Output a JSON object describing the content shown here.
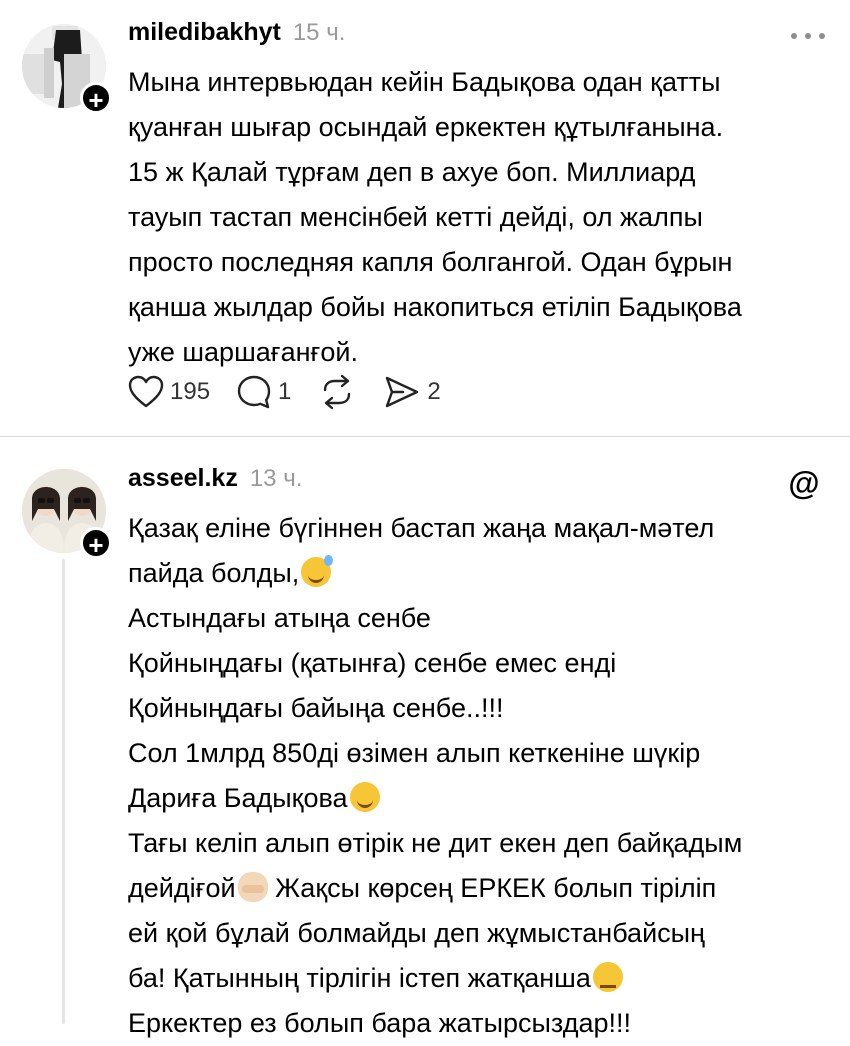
{
  "posts": [
    {
      "username": "miledibakhyt",
      "time": "15 ч.",
      "body_lines": [
        "Мына интервьюдан кейін Бадықова одан қатты",
        "қуанған шығар осындай еркектен құтылғанына.",
        "15 ж Қалай тұрғам деп в ахуе боп. Миллиард",
        "тауып тастап менсінбей кетті дейді, ол жалпы",
        "просто последняя капля болгангой. Одан бұрын",
        "қанша жылдар бойы накопиться етіліп Бадықова",
        "уже шаршағанғой."
      ],
      "likes": "195",
      "replies": "1",
      "shares": "2",
      "menu_icon": "more-horizontal-icon"
    },
    {
      "username": "asseel.kz",
      "time": "13 ч.",
      "body_lines": [
        "Қазақ еліне бүгіннен бастап жаңа мақал-мәтел",
        "пайда болды,",
        "Астындағы атыңа сенбе",
        "Қойныңдағы (қатынға) сенбе емес енді",
        "Қойныңдағы байыңа сенбе..!!!",
        "Сол 1млрд 850ді өзімен алып кеткеніне шүкір",
        "Дариға Бадықова",
        "Тағы келіп алып өтірік не дит екен деп байқадым",
        "дейдіғой",
        " Жақсы көрсең ЕРКЕК болып тіріліп",
        "ей қой бұлай болмайды деп жұмыстанбайсың",
        "ба! Қатынның тірлігін істеп жатқанша",
        "Еркектер ез болып бара жатырсыздар!!!"
      ],
      "brand_icon": "threads-logo-icon",
      "brand_glyph": "@"
    }
  ],
  "follow_glyph": "+",
  "colors": {
    "text": "#000000",
    "muted": "#9a9a9a",
    "divider": "#d9d9d9",
    "thread_line": "#e5e5e5"
  }
}
